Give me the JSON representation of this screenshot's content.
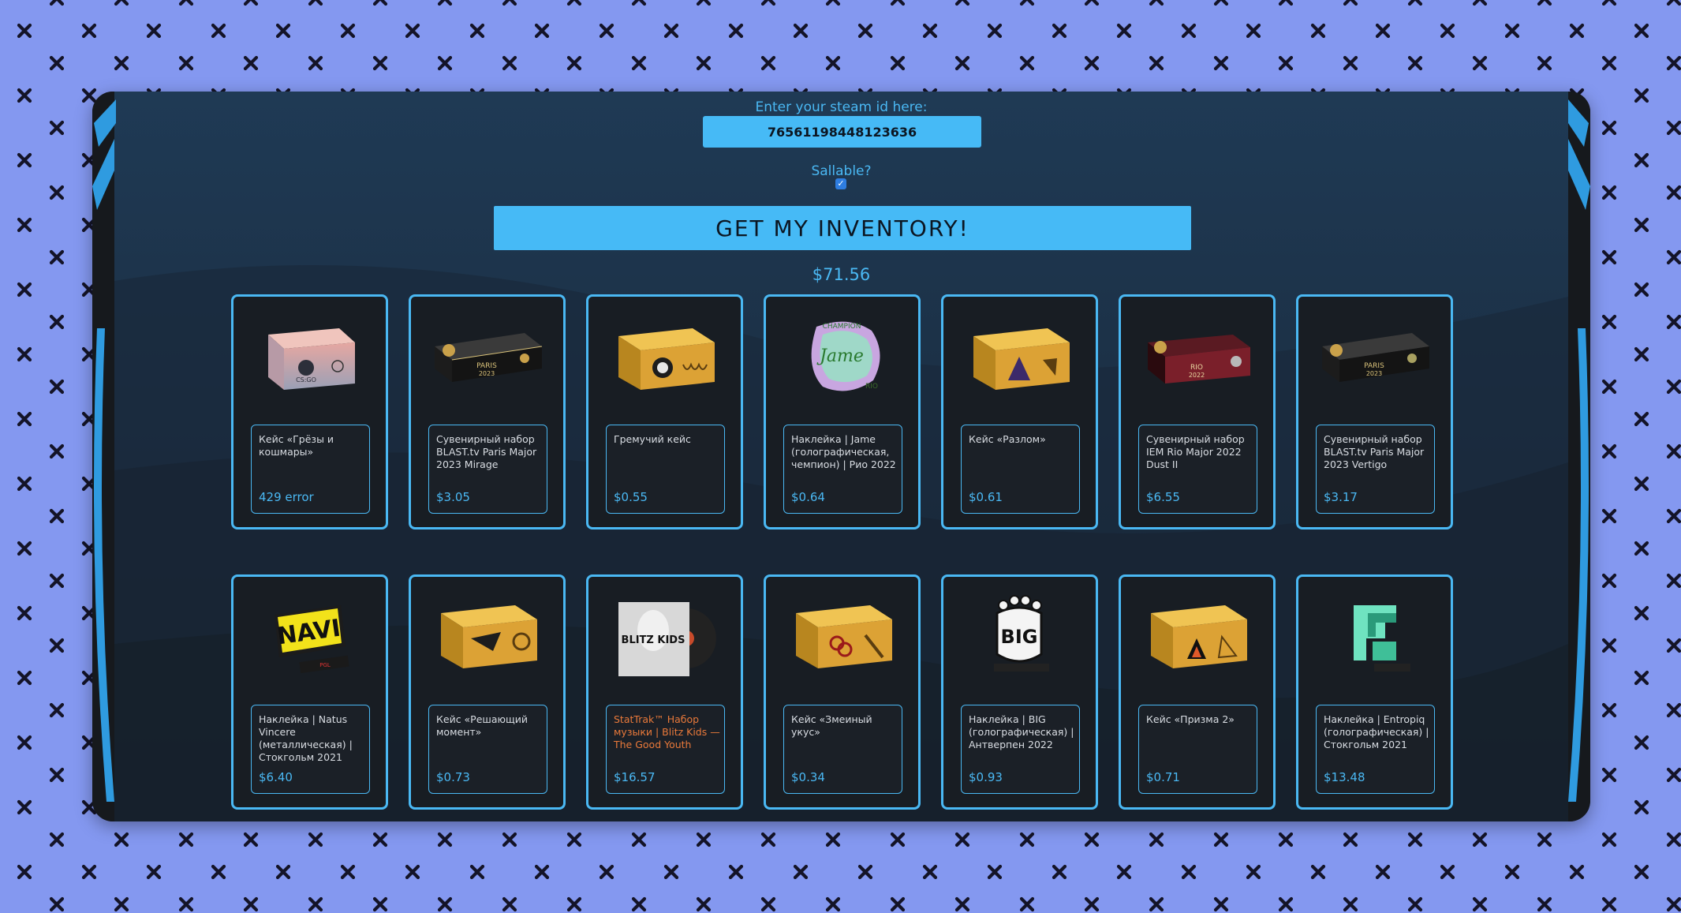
{
  "steam": {
    "label": "Enter your steam id here:",
    "value": "76561198448123636"
  },
  "sellable": {
    "label": "Sallable?",
    "checked": true
  },
  "get_button": "GET MY INVENTORY!",
  "total": "$71.56",
  "items": [
    {
      "name": "Кейс «Грёзы и кошмары»",
      "price": "429 error",
      "icon": "case-dreams-nightmares-icon"
    },
    {
      "name": "Сувенирный набор BLAST.tv Paris Major 2023 Mirage",
      "price": "$3.05",
      "icon": "souvenir-package-icon"
    },
    {
      "name": "Гремучий кейс",
      "price": "$0.55",
      "icon": "weapon-case-icon"
    },
    {
      "name": "Наклейка | Jame (голографическая, чемпион) | Рио 2022",
      "price": "$0.64",
      "icon": "sticker-icon"
    },
    {
      "name": "Кейс «Разлом»",
      "price": "$0.61",
      "icon": "weapon-case-icon"
    },
    {
      "name": "Сувенирный набор IEM Rio Major 2022 Dust II",
      "price": "$6.55",
      "icon": "souvenir-package-icon"
    },
    {
      "name": "Сувенирный набор BLAST.tv Paris Major 2023 Vertigo",
      "price": "$3.17",
      "icon": "souvenir-package-icon"
    },
    {
      "name": "Наклейка | Natus Vincere (металлическая) | Стокгольм 2021",
      "price": "$6.40",
      "icon": "sticker-icon"
    },
    {
      "name": "Кейс «Решающий момент»",
      "price": "$0.73",
      "icon": "weapon-case-icon"
    },
    {
      "name": "StatTrak™ Набор музыки | Blitz Kids — The Good Youth",
      "price": "$16.57",
      "icon": "music-kit-icon",
      "stattrak": true
    },
    {
      "name": "Кейс «Змеиный укус»",
      "price": "$0.34",
      "icon": "weapon-case-icon"
    },
    {
      "name": "Наклейка | BIG (голографическая) | Антверпен 2022",
      "price": "$0.93",
      "icon": "sticker-icon"
    },
    {
      "name": "Кейс «Призма 2»",
      "price": "$0.71",
      "icon": "weapon-case-icon"
    },
    {
      "name": "Наклейка | Entropiq (голографическая) | Стокгольм 2021",
      "price": "$13.48",
      "icon": "sticker-icon"
    }
  ],
  "colors": {
    "accent": "#4ab8f3",
    "page_background": "#8498f0",
    "panel": "#171b20",
    "stattrak": "#e9793a"
  }
}
